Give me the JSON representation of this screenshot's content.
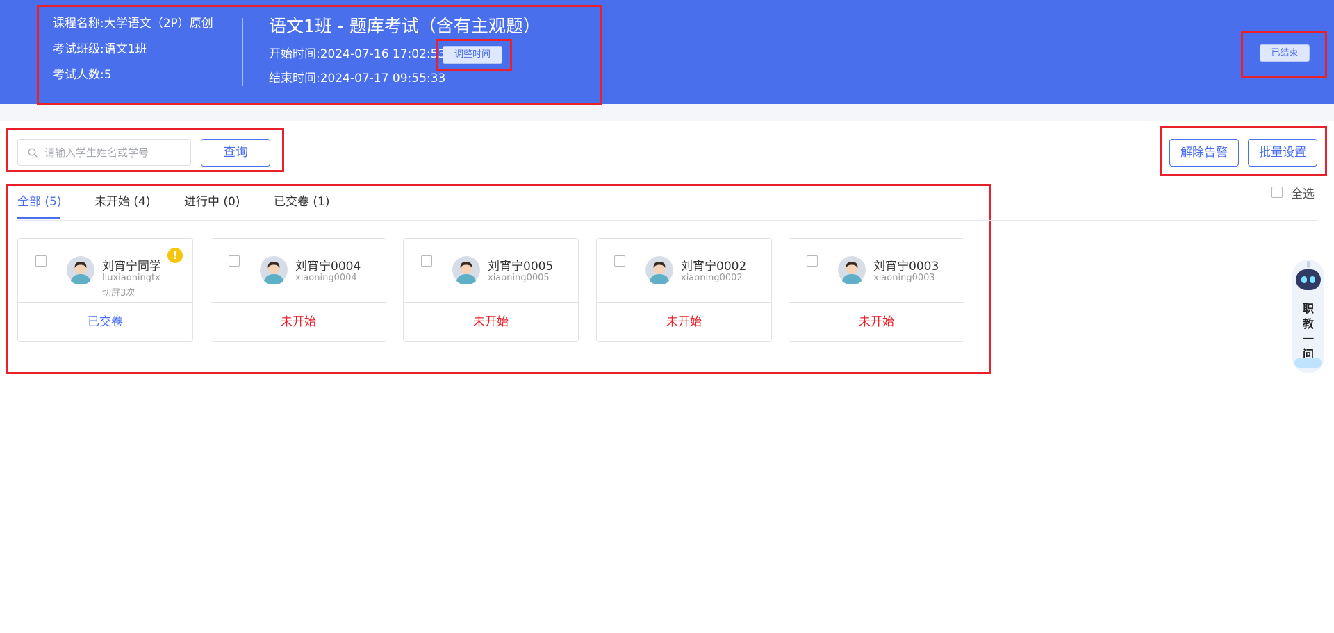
{
  "header": {
    "course_name": "课程名称:大学语文（2P）原创",
    "exam_class": "考试班级:语文1班",
    "exam_count": "考试人数:5",
    "exam_title": "语文1班 - 题库考试（含有主观题）",
    "start_time": "开始时间:2024-07-16 17:02:53",
    "end_time": "结束时间:2024-07-17 09:55:33",
    "adjust_time_label": "调整时间",
    "status_badge": "已结束"
  },
  "search": {
    "placeholder": "请输入学生姓名或学号",
    "query_label": "查询"
  },
  "actions": {
    "clear_alert_label": "解除告警",
    "batch_set_label": "批量设置",
    "select_all_label": "全选"
  },
  "tabs": [
    {
      "label": "全部 (5)",
      "active": true
    },
    {
      "label": "未开始 (4)",
      "active": false
    },
    {
      "label": "进行中 (0)",
      "active": false
    },
    {
      "label": "已交卷 (1)",
      "active": false
    }
  ],
  "students": [
    {
      "name": "刘宵宁同学",
      "account": "liuxiaoningtx",
      "note": "切屏3次",
      "warning": "!",
      "status": "已交卷",
      "status_color": "#4a6fec"
    },
    {
      "name": "刘宵宁0004",
      "account": "xiaoning0004",
      "status": "未开始",
      "status_color": "#e8212a"
    },
    {
      "name": "刘宵宁0005",
      "account": "xiaoning0005",
      "status": "未开始",
      "status_color": "#e8212a"
    },
    {
      "name": "刘宵宁0002",
      "account": "xiaoning0002",
      "status": "未开始",
      "status_color": "#e8212a"
    },
    {
      "name": "刘宵宁0003",
      "account": "xiaoning0003",
      "status": "未开始",
      "status_color": "#e8212a"
    }
  ],
  "assistant": {
    "label_1": "职",
    "label_2": "教",
    "label_3": "一",
    "label_4": "问"
  },
  "colors": {
    "primary": "#4a6fec",
    "highlight_border": "#e8212a",
    "not_started": "#e8212a",
    "warning": "#f5c60b"
  }
}
